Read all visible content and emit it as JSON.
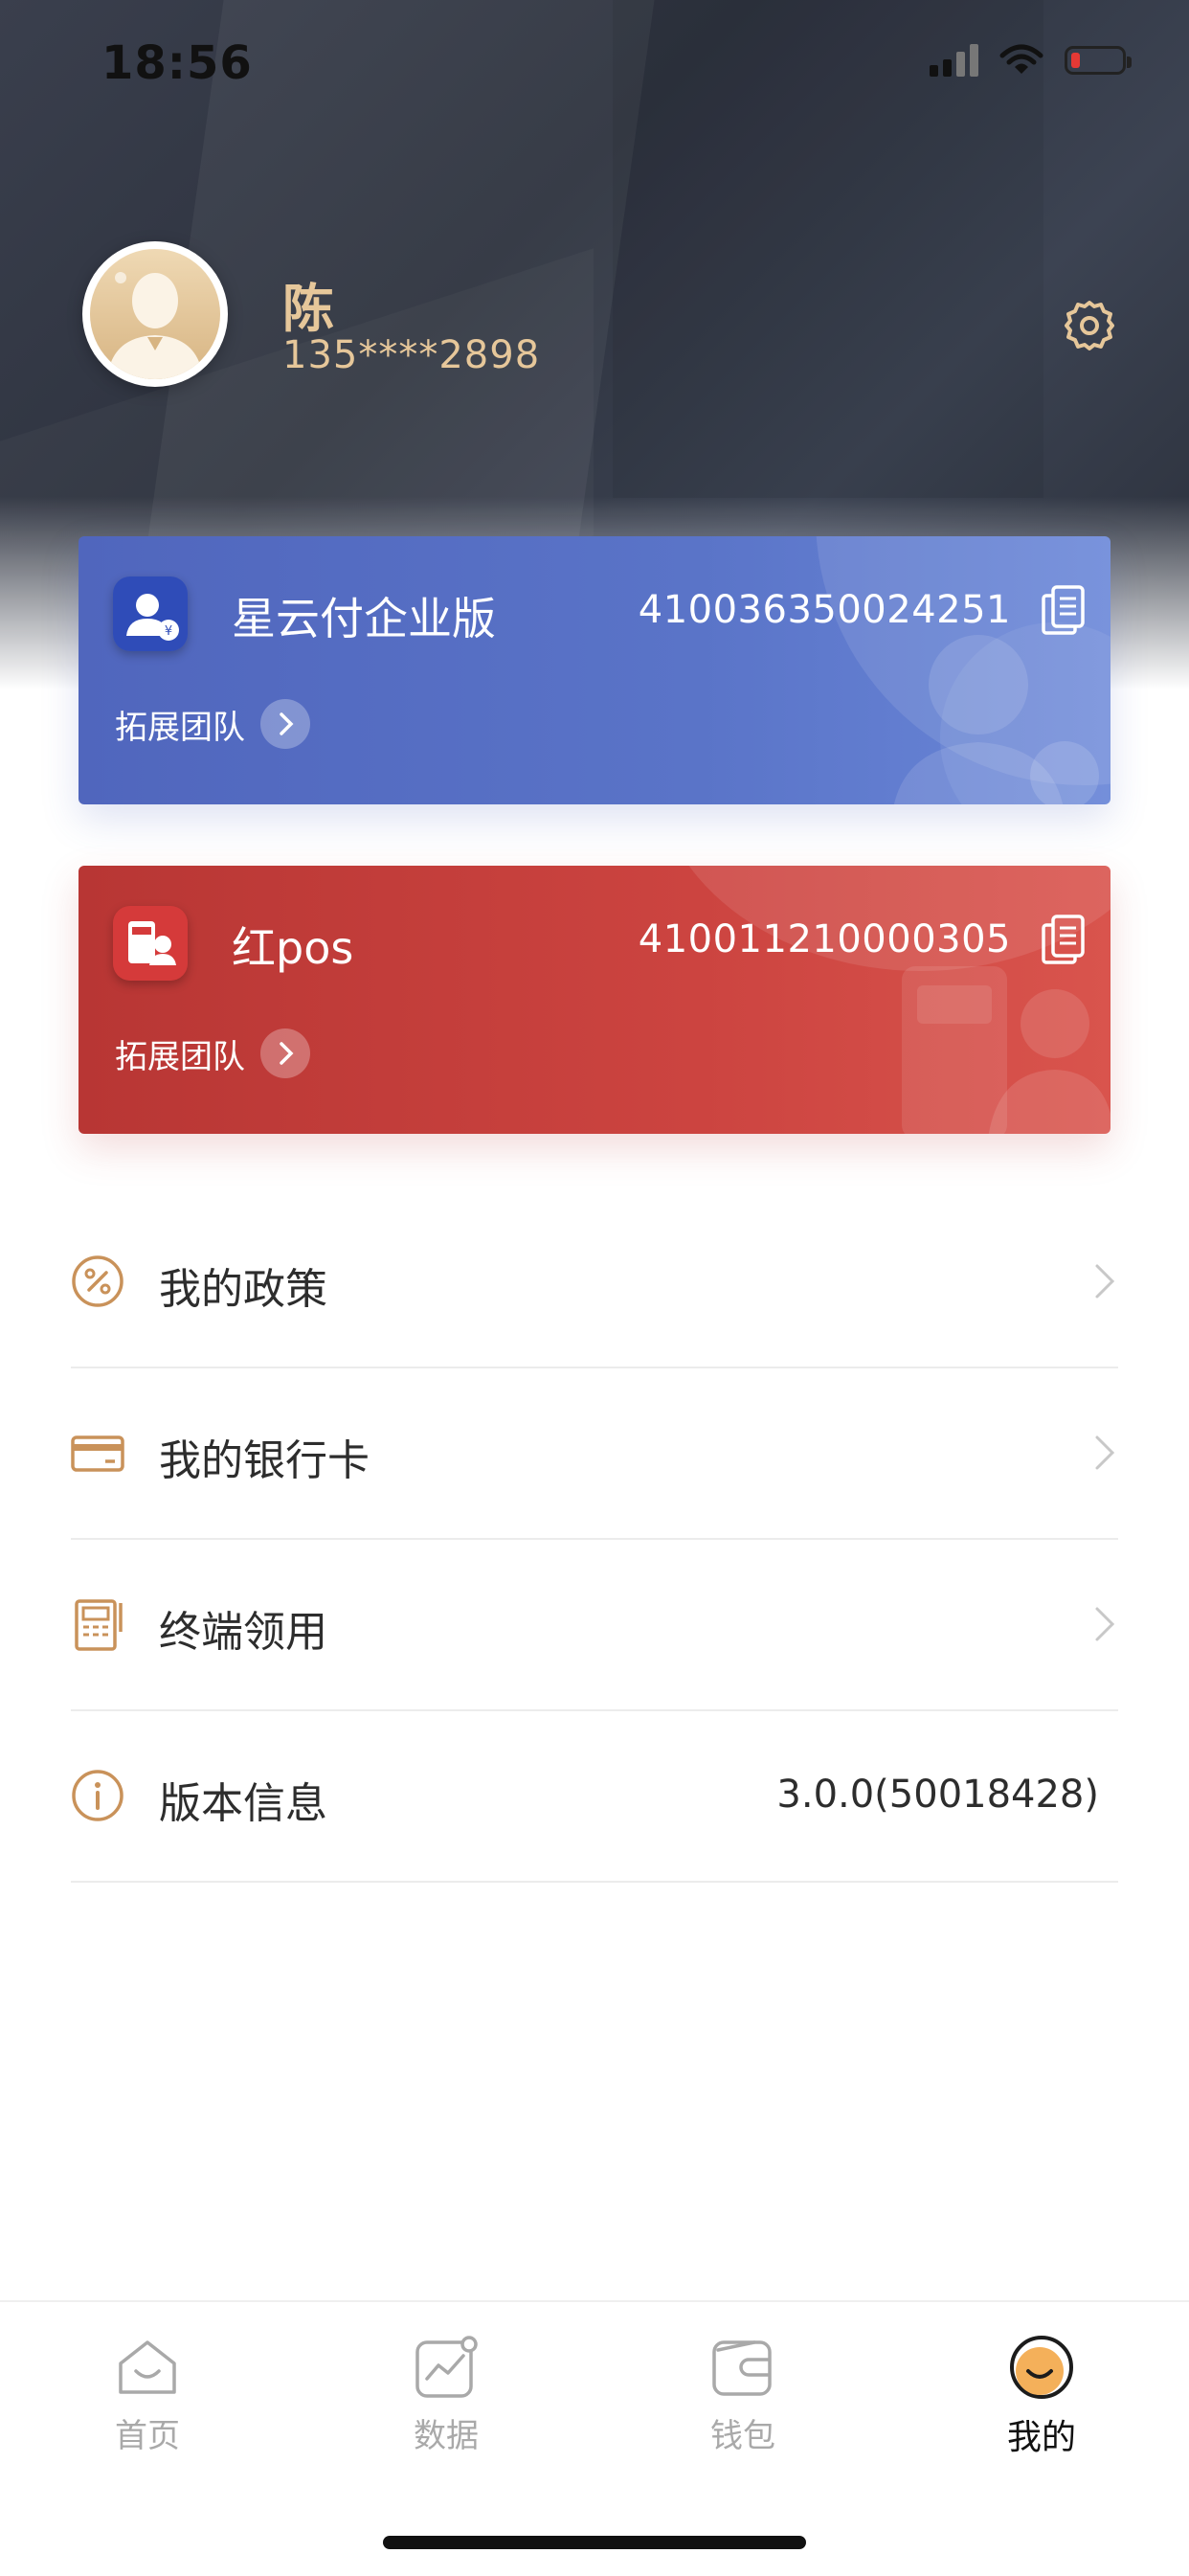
{
  "status_bar": {
    "time": "18:56"
  },
  "profile": {
    "name": "陈",
    "phone": "135****2898"
  },
  "cards": [
    {
      "title": "星云付企业版",
      "number": "410036350024251",
      "expand_label": "拓展团队"
    },
    {
      "title": "红pos",
      "number": "410011210000305",
      "expand_label": "拓展团队"
    }
  ],
  "menu": [
    {
      "label": "我的政策",
      "icon": "percent-icon"
    },
    {
      "label": "我的银行卡",
      "icon": "card-icon"
    },
    {
      "label": "终端领用",
      "icon": "terminal-icon"
    },
    {
      "label": "版本信息",
      "icon": "info-icon",
      "value": "3.0.0(50018428)"
    }
  ],
  "tabbar": [
    {
      "label": "首页",
      "icon": "home-icon"
    },
    {
      "label": "数据",
      "icon": "chart-icon"
    },
    {
      "label": "钱包",
      "icon": "wallet-icon"
    },
    {
      "label": "我的",
      "icon": "smile-icon",
      "active": true
    }
  ],
  "colors": {
    "accent_gold": "#e6c79a",
    "card_blue": "#5a74c8",
    "card_red": "#cc4440",
    "icon_gold": "#c9925a"
  }
}
